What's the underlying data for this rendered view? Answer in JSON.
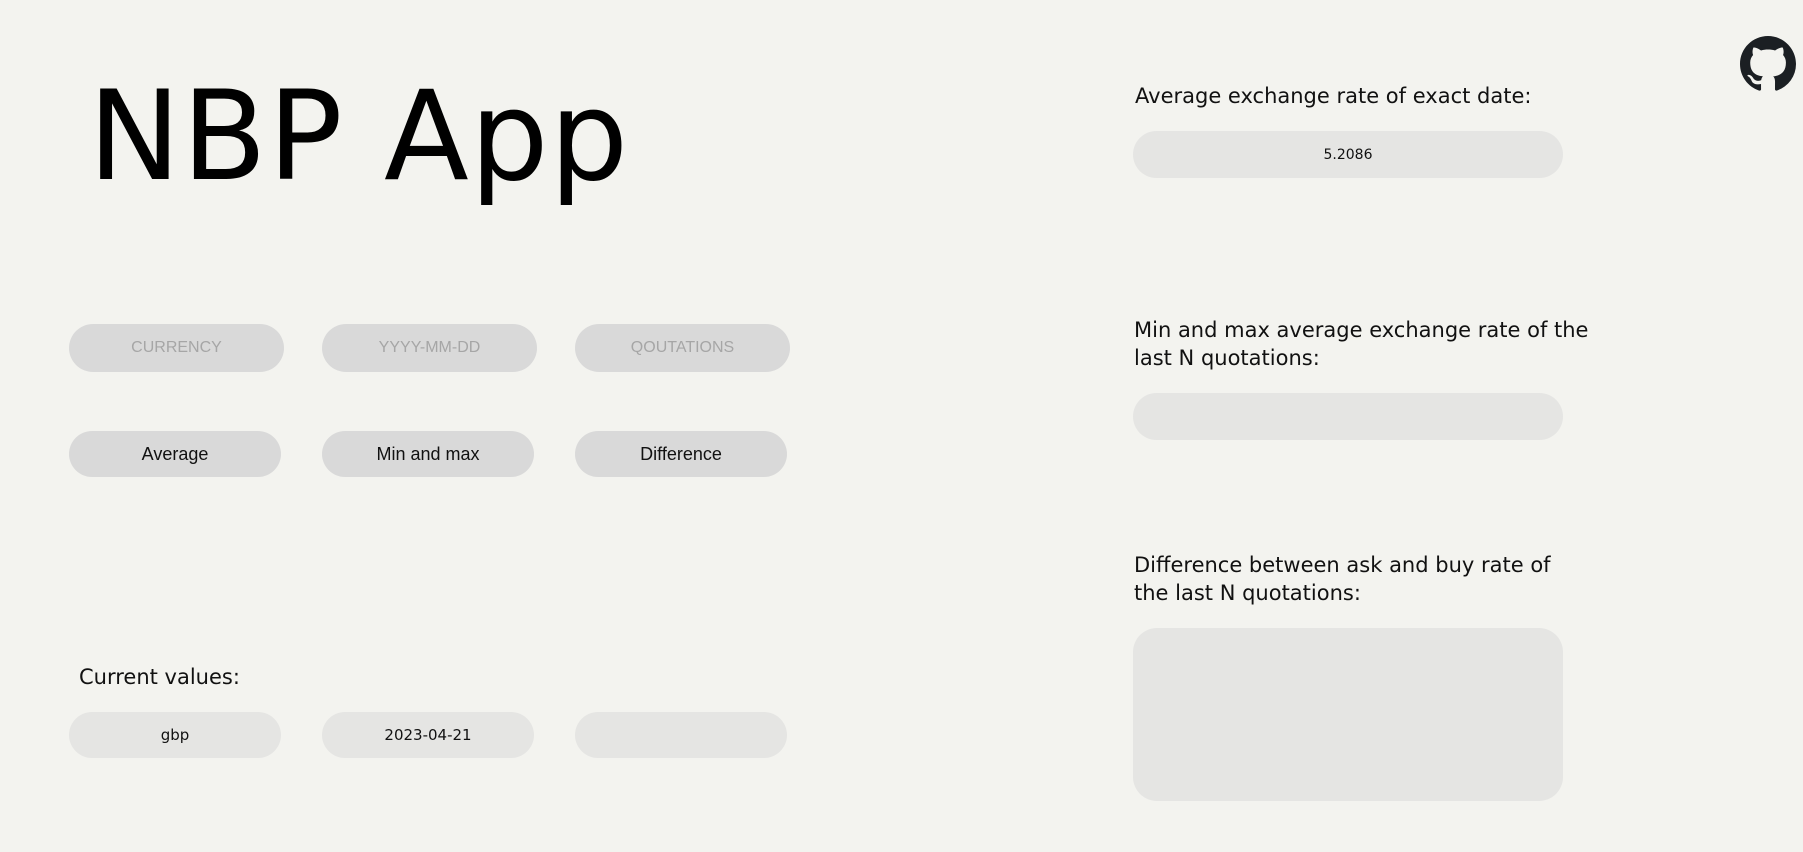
{
  "app": {
    "title": "NBP App"
  },
  "inputs": {
    "currency_placeholder": "CURRENCY",
    "date_placeholder": "YYYY-MM-DD",
    "quotations_placeholder": "QOUTATIONS"
  },
  "buttons": {
    "average": "Average",
    "min_max": "Min and max",
    "difference": "Difference"
  },
  "current": {
    "label": "Current values:",
    "currency": "gbp",
    "date": "2023-04-21",
    "quotations": ""
  },
  "results": {
    "average_label": "Average exchange rate of exact date:",
    "average_value": "5.2086",
    "minmax_label_line1": "Min and max average exchange rate of the",
    "minmax_label_line2": "last N quotations:",
    "minmax_value": "",
    "difference_label_line1": "Difference between ask and buy rate of",
    "difference_label_line2": "the last N quotations:",
    "difference_value": ""
  },
  "icons": {
    "github": "github-icon"
  },
  "colors": {
    "background": "#f3f3ef",
    "pill": "#d9d9d9",
    "value_box": "#e5e5e3",
    "placeholder": "#a6a6a6",
    "text": "#111111"
  }
}
